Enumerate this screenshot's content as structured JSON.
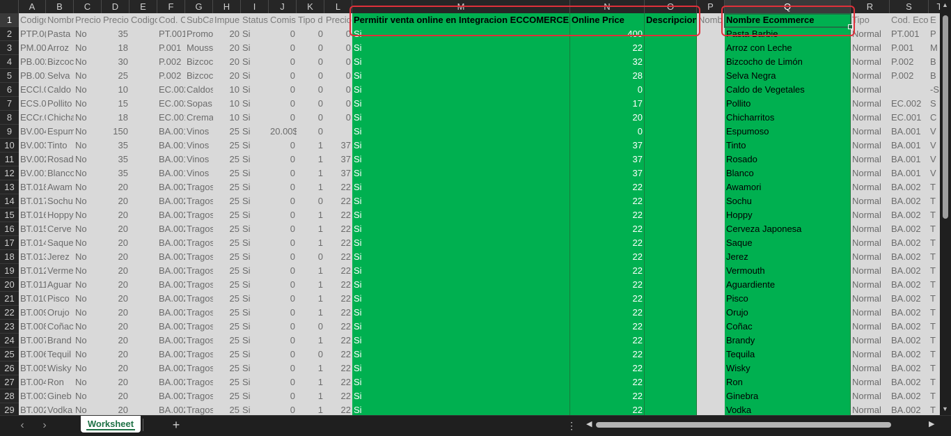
{
  "sheet_tab": "Worksheet",
  "add_sheet": "+",
  "nav": {
    "prev": "‹",
    "next": "›",
    "more": "⋮"
  },
  "columns": [
    {
      "letter": "A",
      "header": "Codigo"
    },
    {
      "letter": "B",
      "header": "Nombre"
    },
    {
      "letter": "C",
      "header": "Precio"
    },
    {
      "letter": "D",
      "header": "Precio"
    },
    {
      "letter": "E",
      "header": "Codigo"
    },
    {
      "letter": "F",
      "header": "Cod. C"
    },
    {
      "letter": "G",
      "header": "SubCa"
    },
    {
      "letter": "H",
      "header": "Impue"
    },
    {
      "letter": "I",
      "header": "Status"
    },
    {
      "letter": "J",
      "header": "Comis"
    },
    {
      "letter": "K",
      "header": "Tipo d"
    },
    {
      "letter": "L",
      "header": "Precio"
    },
    {
      "letter": "M",
      "header": "Permitir venta online en Integracion ECCOMERCE?"
    },
    {
      "letter": "N",
      "header": "Online Price"
    },
    {
      "letter": "O",
      "header": "Descripcion"
    },
    {
      "letter": "P",
      "header": "Nomb"
    },
    {
      "letter": "Q",
      "header": "Nombre Ecommerce"
    },
    {
      "letter": "R",
      "header": "Tipo"
    },
    {
      "letter": "S",
      "header": "Cod. Eco"
    },
    {
      "letter": "T",
      "header": "E"
    }
  ],
  "rows": [
    {
      "n": 2,
      "a": "PTP.0(",
      "b": "Pasta",
      "c": "No",
      "d": "35",
      "f": "PT.001",
      "g": "Promo",
      "h": "20",
      "i": "Si",
      "j": "0",
      "k": "0",
      "l": "0",
      "m": "Si",
      "nval": "400",
      "q": "Pasta Barbie",
      "r": "Normal",
      "s": "PT.001",
      "t": "P"
    },
    {
      "n": 3,
      "a": "PM.00",
      "b": "Arroz",
      "c": "No",
      "d": "18",
      "f": "P.001",
      "g": "Mouss",
      "h": "20",
      "i": "Si",
      "j": "0",
      "k": "0",
      "l": "0",
      "m": "Si",
      "nval": "22",
      "q": "Arroz con Leche",
      "r": "Normal",
      "s": "P.001",
      "t": "M"
    },
    {
      "n": 4,
      "a": "PB.002",
      "b": "Bizcoc",
      "c": "No",
      "d": "30",
      "f": "P.002",
      "g": "Bizcoc",
      "h": "20",
      "i": "Si",
      "j": "0",
      "k": "0",
      "l": "0",
      "m": "Si",
      "nval": "32",
      "q": "Bizcocho de Limón",
      "r": "Normal",
      "s": "P.002",
      "t": "B"
    },
    {
      "n": 5,
      "a": "PB.001",
      "b": "Selva",
      "c": "No",
      "d": "25",
      "f": "P.002",
      "g": "Bizcoc",
      "h": "20",
      "i": "Si",
      "j": "0",
      "k": "0",
      "l": "0",
      "m": "Si",
      "nval": "28",
      "q": "Selva Negra",
      "r": "Normal",
      "s": "P.002",
      "t": "B"
    },
    {
      "n": 6,
      "a": "ECCl.0",
      "b": "Caldo",
      "c": "No",
      "d": "10",
      "f": "EC.002",
      "g": "Caldos",
      "h": "10",
      "i": "Si",
      "j": "0",
      "k": "0",
      "l": "0",
      "m": "Si",
      "nval": "0",
      "q": "Caldo de Vegetales",
      "r": "Normal",
      "s": "",
      "t": "-S"
    },
    {
      "n": 7,
      "a": "ECS.0(",
      "b": "Pollito",
      "c": "No",
      "d": "15",
      "f": "EC.002",
      "g": "Sopas",
      "h": "10",
      "i": "Si",
      "j": "0",
      "k": "0",
      "l": "0",
      "m": "Si",
      "nval": "17",
      "q": "Pollito",
      "r": "Normal",
      "s": "EC.002",
      "t": "S"
    },
    {
      "n": 8,
      "a": "ECCr.0",
      "b": "Chicha",
      "c": "No",
      "d": "18",
      "f": "EC.001",
      "g": "Crema",
      "h": "10",
      "i": "Si",
      "j": "0",
      "k": "0",
      "l": "0",
      "m": "Si",
      "nval": "20",
      "q": "Chicharritos",
      "r": "Normal",
      "s": "EC.001",
      "t": "C"
    },
    {
      "n": 9,
      "a": "BV.004",
      "b": "Espum",
      "c": "No",
      "d": "150",
      "f": "BA.001",
      "g": "Vinos",
      "h": "25",
      "i": "Si",
      "j": "20.00$",
      "k": "0",
      "l": "",
      "m": "Si",
      "nval": "0",
      "q": "Espumoso",
      "r": "Normal",
      "s": "BA.001",
      "t": "V"
    },
    {
      "n": 10,
      "a": "BV.003",
      "b": "Tinto",
      "c": "No",
      "d": "35",
      "f": "BA.001",
      "g": "Vinos",
      "h": "25",
      "i": "Si",
      "j": "0",
      "k": "1",
      "l": "37",
      "m": "Si",
      "nval": "37",
      "q": "Tinto",
      "r": "Normal",
      "s": "BA.001",
      "t": "V"
    },
    {
      "n": 11,
      "a": "BV.002",
      "b": "Rosad",
      "c": "No",
      "d": "35",
      "f": "BA.001",
      "g": "Vinos",
      "h": "25",
      "i": "Si",
      "j": "0",
      "k": "1",
      "l": "37",
      "m": "Si",
      "nval": "37",
      "q": "Rosado",
      "r": "Normal",
      "s": "BA.001",
      "t": "V"
    },
    {
      "n": 12,
      "a": "BV.001",
      "b": "Blanco",
      "c": "No",
      "d": "35",
      "f": "BA.001",
      "g": "Vinos",
      "h": "25",
      "i": "Si",
      "j": "0",
      "k": "1",
      "l": "37",
      "m": "Si",
      "nval": "37",
      "q": "Blanco",
      "r": "Normal",
      "s": "BA.001",
      "t": "V"
    },
    {
      "n": 13,
      "a": "BT.018",
      "b": "Awam",
      "c": "No",
      "d": "20",
      "f": "BA.002",
      "g": "Tragos",
      "h": "25",
      "i": "Si",
      "j": "0",
      "k": "1",
      "l": "22",
      "m": "Si",
      "nval": "22",
      "q": "Awamori",
      "r": "Normal",
      "s": "BA.002",
      "t": "T"
    },
    {
      "n": 14,
      "a": "BT.017",
      "b": "Sochu",
      "c": "No",
      "d": "20",
      "f": "BA.002",
      "g": "Tragos",
      "h": "25",
      "i": "Si",
      "j": "0",
      "k": "0",
      "l": "22",
      "m": "Si",
      "nval": "22",
      "q": "Sochu",
      "r": "Normal",
      "s": "BA.002",
      "t": "T"
    },
    {
      "n": 15,
      "a": "BT.016",
      "b": "Hoppy",
      "c": "No",
      "d": "20",
      "f": "BA.002",
      "g": "Tragos",
      "h": "25",
      "i": "Si",
      "j": "0",
      "k": "1",
      "l": "22",
      "m": "Si",
      "nval": "22",
      "q": "Hoppy",
      "r": "Normal",
      "s": "BA.002",
      "t": "T"
    },
    {
      "n": 16,
      "a": "BT.015",
      "b": "Cerve",
      "c": "No",
      "d": "20",
      "f": "BA.002",
      "g": "Tragos",
      "h": "25",
      "i": "Si",
      "j": "0",
      "k": "1",
      "l": "22",
      "m": "Si",
      "nval": "22",
      "q": "Cerveza Japonesa",
      "r": "Normal",
      "s": "BA.002",
      "t": "T"
    },
    {
      "n": 17,
      "a": "BT.014",
      "b": "Saque",
      "c": "No",
      "d": "20",
      "f": "BA.002",
      "g": "Tragos",
      "h": "25",
      "i": "Si",
      "j": "0",
      "k": "1",
      "l": "22",
      "m": "Si",
      "nval": "22",
      "q": "Saque",
      "r": "Normal",
      "s": "BA.002",
      "t": "T"
    },
    {
      "n": 18,
      "a": "BT.013",
      "b": "Jerez",
      "c": "No",
      "d": "20",
      "f": "BA.002",
      "g": "Tragos",
      "h": "25",
      "i": "Si",
      "j": "0",
      "k": "0",
      "l": "22",
      "m": "Si",
      "nval": "22",
      "q": "Jerez",
      "r": "Normal",
      "s": "BA.002",
      "t": "T"
    },
    {
      "n": 19,
      "a": "BT.012",
      "b": "Verme",
      "c": "No",
      "d": "20",
      "f": "BA.002",
      "g": "Tragos",
      "h": "25",
      "i": "Si",
      "j": "0",
      "k": "1",
      "l": "22",
      "m": "Si",
      "nval": "22",
      "q": "Vermouth",
      "r": "Normal",
      "s": "BA.002",
      "t": "T"
    },
    {
      "n": 20,
      "a": "BT.011",
      "b": "Aguar",
      "c": "No",
      "d": "20",
      "f": "BA.002",
      "g": "Tragos",
      "h": "25",
      "i": "Si",
      "j": "0",
      "k": "1",
      "l": "22",
      "m": "Si",
      "nval": "22",
      "q": "Aguardiente",
      "r": "Normal",
      "s": "BA.002",
      "t": "T"
    },
    {
      "n": 21,
      "a": "BT.010",
      "b": "Pisco",
      "c": "No",
      "d": "20",
      "f": "BA.002",
      "g": "Tragos",
      "h": "25",
      "i": "Si",
      "j": "0",
      "k": "1",
      "l": "22",
      "m": "Si",
      "nval": "22",
      "q": "Pisco",
      "r": "Normal",
      "s": "BA.002",
      "t": "T"
    },
    {
      "n": 22,
      "a": "BT.009",
      "b": "Orujo",
      "c": "No",
      "d": "20",
      "f": "BA.002",
      "g": "Tragos",
      "h": "25",
      "i": "Si",
      "j": "0",
      "k": "1",
      "l": "22",
      "m": "Si",
      "nval": "22",
      "q": "Orujo",
      "r": "Normal",
      "s": "BA.002",
      "t": "T"
    },
    {
      "n": 23,
      "a": "BT.008",
      "b": "Coñac",
      "c": "No",
      "d": "20",
      "f": "BA.002",
      "g": "Tragos",
      "h": "25",
      "i": "Si",
      "j": "0",
      "k": "0",
      "l": "22",
      "m": "Si",
      "nval": "22",
      "q": "Coñac",
      "r": "Normal",
      "s": "BA.002",
      "t": "T"
    },
    {
      "n": 24,
      "a": "BT.007",
      "b": "Brand",
      "c": "No",
      "d": "20",
      "f": "BA.002",
      "g": "Tragos",
      "h": "25",
      "i": "Si",
      "j": "0",
      "k": "1",
      "l": "22",
      "m": "Si",
      "nval": "22",
      "q": "Brandy",
      "r": "Normal",
      "s": "BA.002",
      "t": "T"
    },
    {
      "n": 25,
      "a": "BT.006",
      "b": "Tequil",
      "c": "No",
      "d": "20",
      "f": "BA.002",
      "g": "Tragos",
      "h": "25",
      "i": "Si",
      "j": "0",
      "k": "0",
      "l": "22",
      "m": "Si",
      "nval": "22",
      "q": "Tequila",
      "r": "Normal",
      "s": "BA.002",
      "t": "T"
    },
    {
      "n": 26,
      "a": "BT.005",
      "b": "Wisky",
      "c": "No",
      "d": "20",
      "f": "BA.002",
      "g": "Tragos",
      "h": "25",
      "i": "Si",
      "j": "0",
      "k": "1",
      "l": "22",
      "m": "Si",
      "nval": "22",
      "q": "Wisky",
      "r": "Normal",
      "s": "BA.002",
      "t": "T"
    },
    {
      "n": 27,
      "a": "BT.004",
      "b": "Ron",
      "c": "No",
      "d": "20",
      "f": "BA.002",
      "g": "Tragos",
      "h": "25",
      "i": "Si",
      "j": "0",
      "k": "1",
      "l": "22",
      "m": "Si",
      "nval": "22",
      "q": "Ron",
      "r": "Normal",
      "s": "BA.002",
      "t": "T"
    },
    {
      "n": 28,
      "a": "BT.003",
      "b": "Gineb",
      "c": "No",
      "d": "20",
      "f": "BA.002",
      "g": "Tragos",
      "h": "25",
      "i": "Si",
      "j": "0",
      "k": "1",
      "l": "22",
      "m": "Si",
      "nval": "22",
      "q": "Ginebra",
      "r": "Normal",
      "s": "BA.002",
      "t": "T"
    },
    {
      "n": 29,
      "a": "BT.002",
      "b": "Vodka",
      "c": "No",
      "d": "20",
      "f": "BA.002",
      "g": "Tragos",
      "h": "25",
      "i": "Si",
      "j": "0",
      "k": "1",
      "l": "22",
      "m": "Si",
      "nval": "22",
      "q": "Vodka",
      "r": "Normal",
      "s": "BA.002",
      "t": "T"
    }
  ],
  "colors": {
    "highlight_green": "#00b050",
    "annotation_red": "#e0303a",
    "excel_green": "#1e7145"
  }
}
